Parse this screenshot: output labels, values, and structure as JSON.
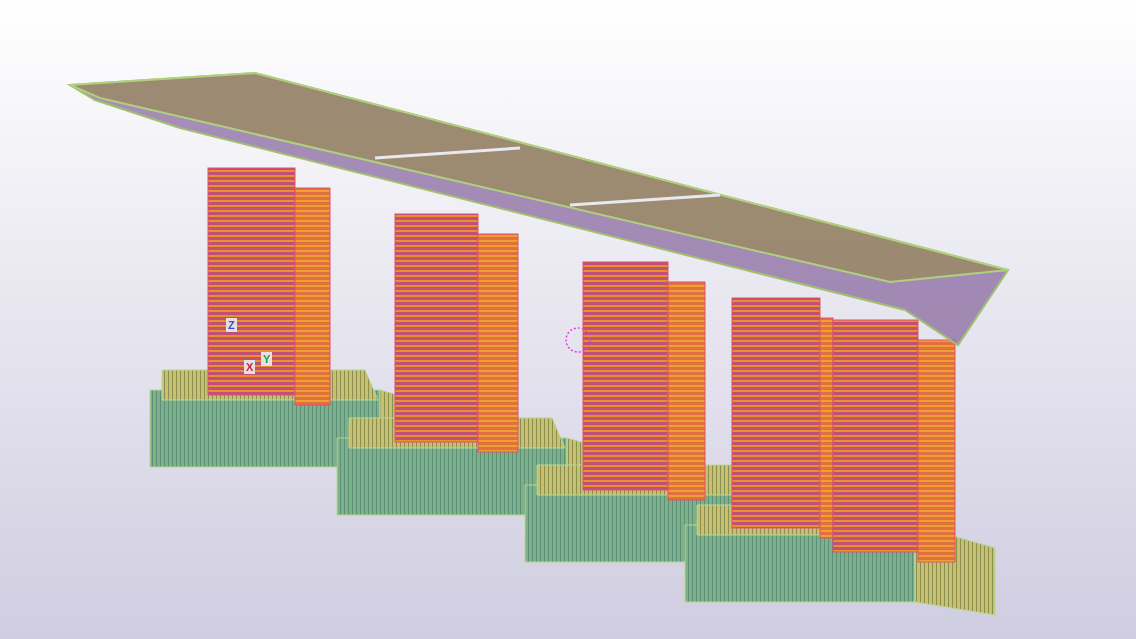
{
  "viewport": {
    "axis_labels": [
      {
        "text": "Z",
        "color": "#3a4fd0"
      },
      {
        "text": "X",
        "color": "#d0203a"
      },
      {
        "text": "Y",
        "color": "#20a040"
      }
    ]
  }
}
